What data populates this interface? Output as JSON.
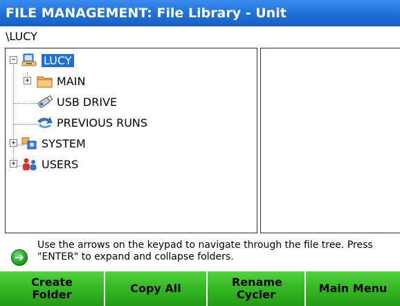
{
  "window": {
    "title": "FILE MANAGEMENT: File Library - Unit"
  },
  "path": "\\LUCY",
  "tree": {
    "root": {
      "label": "LUCY",
      "icon": "computer-folder-icon",
      "expander": "−",
      "selected": true
    },
    "items": [
      {
        "label": "MAIN",
        "icon": "folder-icon",
        "expander": "+"
      },
      {
        "label": "USB DRIVE",
        "icon": "usb-drive-icon"
      },
      {
        "label": "PREVIOUS RUNS",
        "icon": "previous-runs-icon"
      },
      {
        "label": "SYSTEM",
        "icon": "system-icon",
        "expander": "+"
      },
      {
        "label": "USERS",
        "icon": "users-icon",
        "expander": "+"
      }
    ]
  },
  "hint": {
    "icon": "arrow-right-icon",
    "text": "Use the arrows on the keypad to navigate through the file tree.  Press \"ENTER\" to expand and collapse folders."
  },
  "softkeys": {
    "create_folder": "Create Folder",
    "copy_all": "Copy All",
    "rename_cycler": "Rename Cycler",
    "main_menu": "Main Menu"
  },
  "colors": {
    "title_bar": "#1f6fd6",
    "selection": "#1f6fd6",
    "softkey_green": "#2fb31f"
  }
}
